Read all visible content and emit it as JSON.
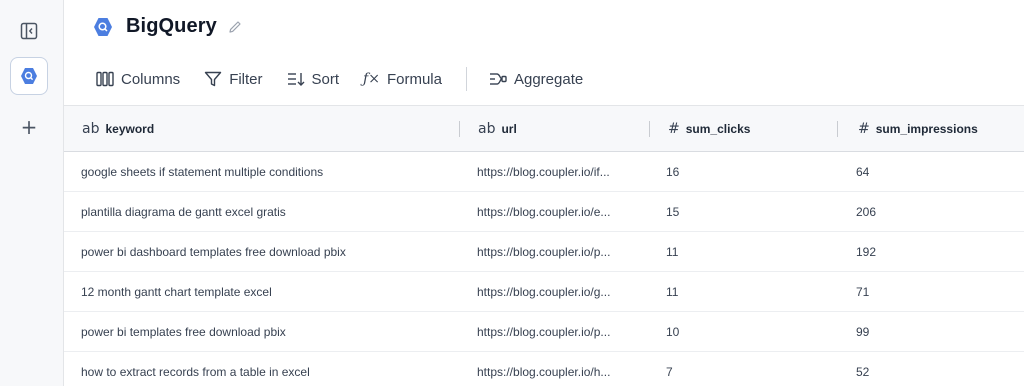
{
  "rail": {
    "toggle_icon": "sidebar-collapse-icon",
    "active_source_icon": "bigquery-icon",
    "add_label": "+"
  },
  "header": {
    "title": "BigQuery",
    "brand_color": "#4c7ee0"
  },
  "toolbar": {
    "columns_label": "Columns",
    "filter_label": "Filter",
    "sort_label": "Sort",
    "formula_label": "Formula",
    "formula_glyph": "ƒ×",
    "aggregate_label": "Aggregate"
  },
  "table": {
    "columns": [
      {
        "type": "ab",
        "name": "keyword"
      },
      {
        "type": "ab",
        "name": "url"
      },
      {
        "type": "#",
        "name": "sum_clicks"
      },
      {
        "type": "#",
        "name": "sum_impressions"
      }
    ],
    "rows": [
      {
        "keyword": "google sheets if statement multiple conditions",
        "url": "https://blog.coupler.io/if...",
        "sum_clicks": "16",
        "sum_impressions": "64"
      },
      {
        "keyword": "plantilla diagrama de gantt excel gratis",
        "url": "https://blog.coupler.io/e...",
        "sum_clicks": "15",
        "sum_impressions": "206"
      },
      {
        "keyword": "power bi dashboard templates free download pbix",
        "url": "https://blog.coupler.io/p...",
        "sum_clicks": "11",
        "sum_impressions": "192"
      },
      {
        "keyword": "12 month gantt chart template excel",
        "url": "https://blog.coupler.io/g...",
        "sum_clicks": "11",
        "sum_impressions": "71"
      },
      {
        "keyword": "power bi templates free download pbix",
        "url": "https://blog.coupler.io/p...",
        "sum_clicks": "10",
        "sum_impressions": "99"
      },
      {
        "keyword": "how to extract records from a table in excel",
        "url": "https://blog.coupler.io/h...",
        "sum_clicks": "7",
        "sum_impressions": "52"
      }
    ]
  }
}
